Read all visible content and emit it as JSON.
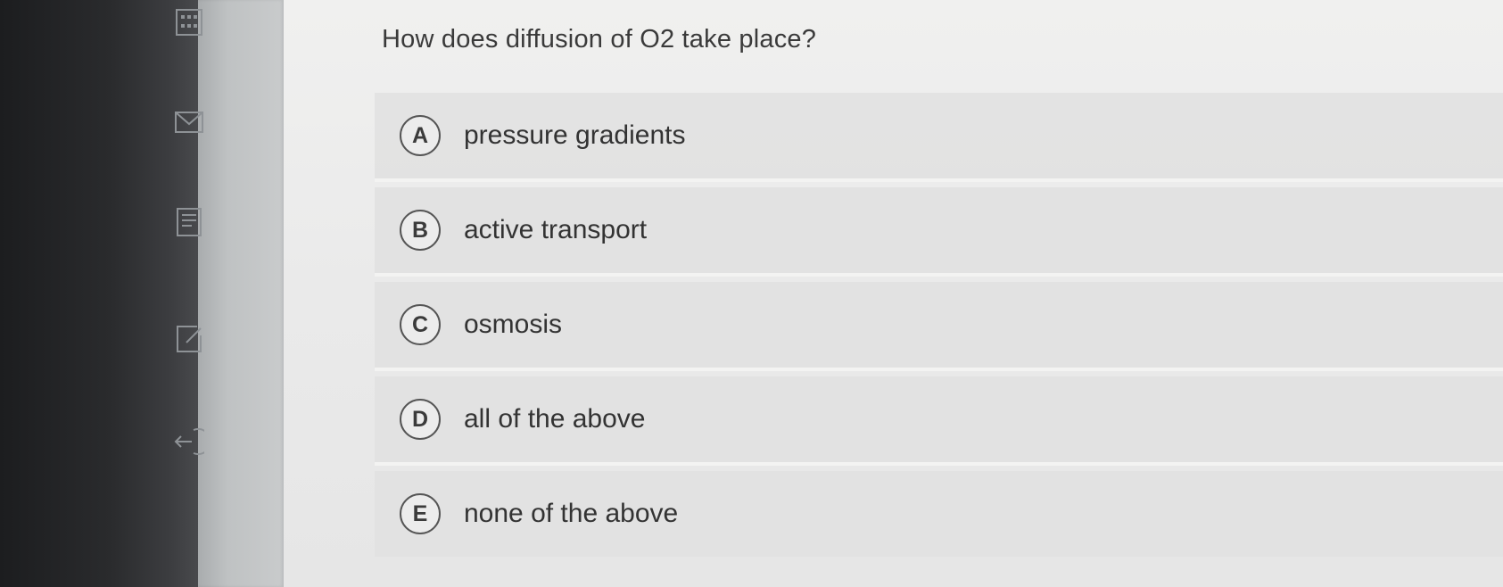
{
  "quiz": {
    "question": "How does diffusion of O2 take place?",
    "options": [
      {
        "letter": "A",
        "text": "pressure gradients"
      },
      {
        "letter": "B",
        "text": "active transport"
      },
      {
        "letter": "C",
        "text": "osmosis"
      },
      {
        "letter": "D",
        "text": "all of the above"
      },
      {
        "letter": "E",
        "text": "none of the above"
      }
    ]
  },
  "rail": {
    "icons": [
      "calculator-icon",
      "mail-icon",
      "document-icon",
      "edit-icon",
      "exit-icon"
    ]
  },
  "colors": {
    "background": "#e9e9e9",
    "option_background": "#e1e1e0",
    "text": "#333333",
    "badge_border": "#555555",
    "bezel": "#1c1d1f"
  }
}
